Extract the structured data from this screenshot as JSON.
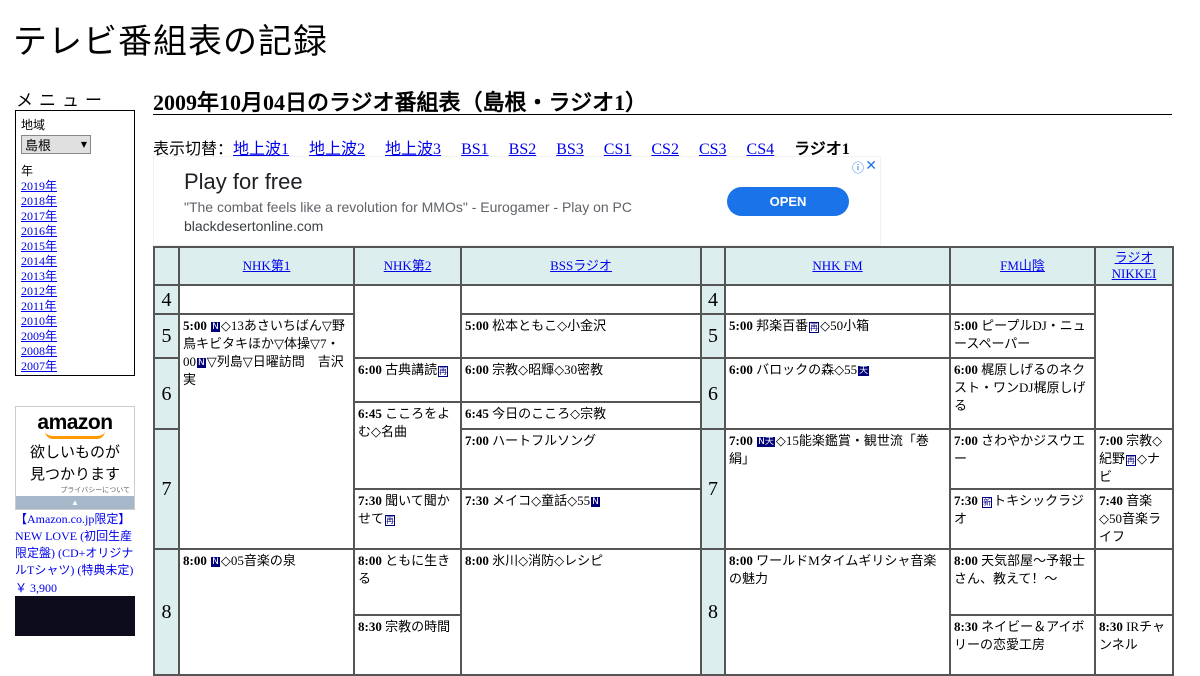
{
  "site_title": "テレビ番組表の記録",
  "menu": {
    "title": "メニュー",
    "region_label": "地域",
    "region_value": "島根",
    "year_label": "年",
    "years": [
      "2019年",
      "2018年",
      "2017年",
      "2016年",
      "2015年",
      "2014年",
      "2013年",
      "2012年",
      "2011年",
      "2010年",
      "2009年",
      "2008年",
      "2007年"
    ]
  },
  "amazon": {
    "logo": "amazon",
    "copy_line1": "欲しいものが",
    "copy_line2": "見つかります",
    "privacy": "プライバシーについて",
    "link_text": "【Amazon.co.jp限定】NEW LOVE (初回生産限定盤) (CD+オリジナルTシャツ) (特典未定)",
    "price": "￥ 3,900"
  },
  "page_title": "2009年10月04日のラジオ番組表（島根・ラジオ1）",
  "switcher": {
    "label": "表示切替：",
    "links": [
      "地上波1",
      "地上波2",
      "地上波3",
      "BS1",
      "BS2",
      "BS3",
      "CS1",
      "CS2",
      "CS3",
      "CS4"
    ],
    "current": "ラジオ1"
  },
  "ad": {
    "headline": "Play for free",
    "quote": "\"The combat feels like a revolution for MMOs\" - Eurogamer - Play on PC",
    "domain": "blackdesertonline.com",
    "button": "OPEN",
    "choices_icon": "ⓘ",
    "close_icon": "✕"
  },
  "channels": [
    "NHK第1",
    "NHK第2",
    "BSSラジオ",
    "NHK FM",
    "FM山陰",
    "ラジオNIKKEI"
  ],
  "hours": [
    "4",
    "5",
    "6",
    "7",
    "8"
  ],
  "programs": {
    "nhk1_500": {
      "time": "5:00",
      "pre": "",
      "icon": "N",
      "title": "◇13あさいちばん▽野鳥キビタキほか▽体操▽7・00",
      "icon2": "N",
      "tail": "▽列島▽日曜訪問　吉沢実"
    },
    "nhk1_800": {
      "time": "8:00",
      "icon": "N",
      "title": "◇05音楽の泉"
    },
    "nhk2_600": {
      "time": "6:00",
      "title": "古典講読",
      "icon": "再"
    },
    "nhk2_645": {
      "time": "6:45",
      "title": "こころをよむ◇名曲"
    },
    "nhk2_730": {
      "time": "7:30",
      "title": "聞いて聞かせて",
      "icon": "再"
    },
    "nhk2_800": {
      "time": "8:00",
      "title": "ともに生きる"
    },
    "nhk2_830": {
      "time": "8:30",
      "title": "宗教の時間"
    },
    "bss_500": {
      "time": "5:00",
      "title": "松本ともこ◇小金沢"
    },
    "bss_600": {
      "time": "6:00",
      "title": "宗教◇昭輝◇30密教"
    },
    "bss_645": {
      "time": "6:45",
      "title": "今日のこころ◇宗教"
    },
    "bss_700": {
      "time": "7:00",
      "title": "ハートフルソング"
    },
    "bss_730": {
      "time": "7:30",
      "title": "メイコ◇童話◇55",
      "icon": "N"
    },
    "bss_800": {
      "time": "8:00",
      "title": "氷川◇消防◇レシピ"
    },
    "fm_500": {
      "time": "5:00",
      "title": "邦楽百番",
      "icon": "再",
      "tail": "◇50小箱"
    },
    "fm_600": {
      "time": "6:00",
      "title": "バロックの森◇55",
      "icon": "天"
    },
    "fm_700": {
      "time": "7:00",
      "icon": "N天",
      "title": "◇15能楽鑑賞・観世流「巻絹」"
    },
    "fm_800": {
      "time": "8:00",
      "title": "ワールドMタイムギリシャ音楽の魅力"
    },
    "sanin_500": {
      "time": "5:00",
      "title": "ピープルDJ・ニュースペーパー"
    },
    "sanin_600": {
      "time": "6:00",
      "title": "梶原しげるのネクスト・ワンDJ梶原しげる"
    },
    "sanin_700": {
      "time": "7:00",
      "title": "さわやかジスウエー"
    },
    "sanin_730": {
      "time": "7:30",
      "icon": "新",
      "title": "トキシックラジオ"
    },
    "sanin_800": {
      "time": "8:00",
      "title": "天気部屋～予報士さん、教えて！～"
    },
    "sanin_830": {
      "time": "8:30",
      "title": "ネイビー＆アイボリーの恋愛工房"
    },
    "nikkei_700": {
      "time": "7:00",
      "title": "宗教◇紀野",
      "icon": "再",
      "tail": "◇ナビ"
    },
    "nikkei_740": {
      "time": "7:40",
      "title": "音楽◇50音楽ライフ"
    },
    "nikkei_830": {
      "time": "8:30",
      "title": "IRチャンネル"
    }
  }
}
